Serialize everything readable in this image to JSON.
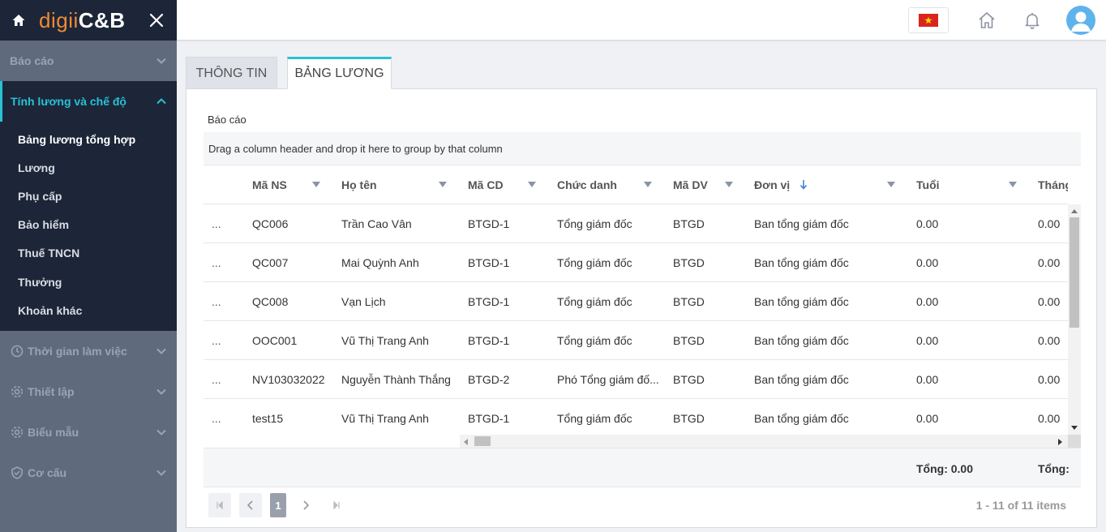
{
  "app": {
    "logo_part1": "digii",
    "logo_part2": "C&B"
  },
  "sidebar": {
    "groups": [
      {
        "label": "Báo cáo",
        "icon": "none",
        "expanded": false
      },
      {
        "label": "Tính lương và chế độ",
        "icon": "none",
        "expanded": true,
        "active": true
      },
      {
        "label": "Thời gian làm việc",
        "icon": "clock-gear-icon",
        "expanded": false
      },
      {
        "label": "Thiết lập",
        "icon": "gear-icon",
        "expanded": false
      },
      {
        "label": "Biểu mẫu",
        "icon": "gear-icon",
        "expanded": false
      },
      {
        "label": "Cơ cấu",
        "icon": "shield-check-icon",
        "expanded": false
      }
    ],
    "subitems": [
      {
        "label": "Bảng lương tổng hợp",
        "current": true
      },
      {
        "label": "Lương"
      },
      {
        "label": "Phụ cấp"
      },
      {
        "label": "Bảo hiểm"
      },
      {
        "label": "Thuế TNCN"
      },
      {
        "label": "Thưởng"
      },
      {
        "label": "Khoản khác"
      }
    ],
    "colors": {
      "dark": "#1c2638",
      "accent": "#29c1d4",
      "brand_orange": "#ef8a34"
    }
  },
  "topbar": {
    "language_flag": "vietnam-flag-icon",
    "icons": [
      "home-icon",
      "bell-icon",
      "user-avatar-icon"
    ]
  },
  "tabs": [
    {
      "label": "THÔNG TIN",
      "active": false
    },
    {
      "label": "BẢNG LƯƠNG",
      "active": true
    }
  ],
  "report": {
    "title": "Báo cáo",
    "group_hint": "Drag a column header and drop it here to group by that column"
  },
  "table": {
    "columns": [
      {
        "label": "Mã NS",
        "filter": true
      },
      {
        "label": "Họ tên",
        "filter": true
      },
      {
        "label": "Mã CD",
        "filter": true
      },
      {
        "label": "Chức danh",
        "filter": true
      },
      {
        "label": "Mã DV",
        "filter": true
      },
      {
        "label": "Đơn vị",
        "filter": true,
        "sort": "desc"
      },
      {
        "label": "Tuổi",
        "filter": true
      },
      {
        "label": "Tháng",
        "filter": false
      }
    ],
    "rows": [
      {
        "menu": "...",
        "ma_ns": "QC006",
        "ho_ten": "Trần Cao Vân",
        "ma_cd": "BTGD-1",
        "chuc_danh": "Tổng giám đốc",
        "ma_dv": "BTGD",
        "don_vi": "Ban tổng giám đốc",
        "tuoi": "0.00",
        "thang": "0.00"
      },
      {
        "menu": "...",
        "ma_ns": "QC007",
        "ho_ten": "Mai Quỳnh Anh",
        "ma_cd": "BTGD-1",
        "chuc_danh": "Tổng giám đốc",
        "ma_dv": "BTGD",
        "don_vi": "Ban tổng giám đốc",
        "tuoi": "0.00",
        "thang": "0.00"
      },
      {
        "menu": "...",
        "ma_ns": "QC008",
        "ho_ten": "Vạn Lịch",
        "ma_cd": "BTGD-1",
        "chuc_danh": "Tổng giám đốc",
        "ma_dv": "BTGD",
        "don_vi": "Ban tổng giám đốc",
        "tuoi": "0.00",
        "thang": "0.00"
      },
      {
        "menu": "...",
        "ma_ns": "OOC001",
        "ho_ten": "Vũ Thị Trang Anh",
        "ma_cd": "BTGD-1",
        "chuc_danh": "Tổng giám đốc",
        "ma_dv": "BTGD",
        "don_vi": "Ban tổng giám đốc",
        "tuoi": "0.00",
        "thang": "0.00"
      },
      {
        "menu": "...",
        "ma_ns": "NV103032022",
        "ho_ten": "Nguyễn Thành Thắng",
        "ma_cd": "BTGD-2",
        "chuc_danh": "Phó Tổng giám đố...",
        "ma_dv": "BTGD",
        "don_vi": "Ban tổng giám đốc",
        "tuoi": "0.00",
        "thang": "0.00"
      },
      {
        "menu": "...",
        "ma_ns": "test15",
        "ho_ten": "Vũ Thị Trang Anh",
        "ma_cd": "BTGD-1",
        "chuc_danh": "Tổng giám đốc",
        "ma_dv": "BTGD",
        "don_vi": "Ban tổng giám đốc",
        "tuoi": "0.00",
        "thang": "0.00"
      }
    ],
    "footer": {
      "tuoi_total": "Tổng: 0.00",
      "thang_total": "Tổng:"
    }
  },
  "pager": {
    "current_page": "1",
    "info": "1 - 11 of 11 items"
  }
}
